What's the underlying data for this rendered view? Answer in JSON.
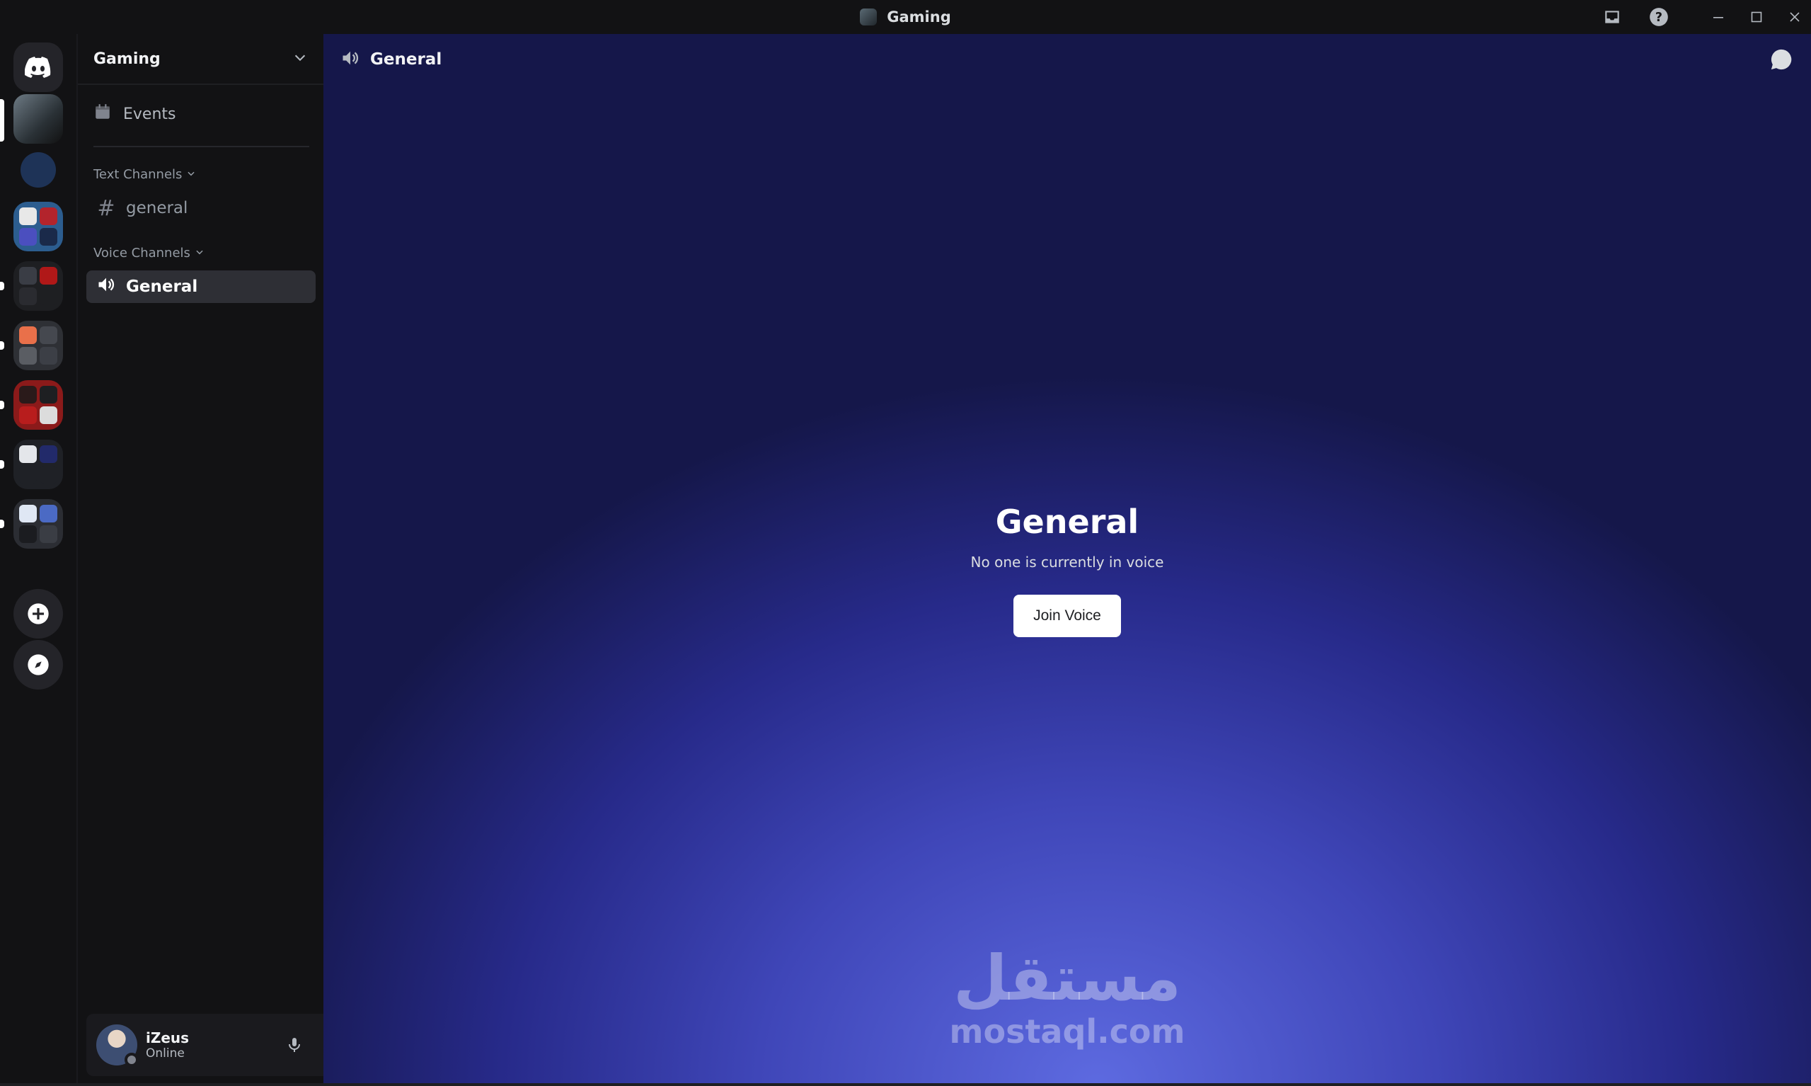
{
  "window": {
    "title": "Gaming",
    "icons": {
      "inbox": "inbox-icon",
      "help": "help-icon",
      "minimize": "minimize-icon",
      "maximize": "maximize-icon",
      "close": "close-icon"
    }
  },
  "server": {
    "name": "Gaming",
    "events_label": "Events",
    "text_category": "Text Channels",
    "voice_category": "Voice Channels",
    "text_channels": [
      {
        "name": "general"
      }
    ],
    "voice_channels": [
      {
        "name": "General",
        "active": true
      }
    ]
  },
  "main": {
    "header_title": "General",
    "voice_title": "General",
    "voice_subtitle": "No one is currently in voice",
    "join_label": "Join Voice"
  },
  "user": {
    "name": "iZeus",
    "status": "Online"
  },
  "watermark": {
    "arabic": "مستقل",
    "latin": "mostaql.com"
  },
  "colors": {
    "accent_blurple": "#5865f2",
    "background": "#121214",
    "active_channel": "#2e2f35"
  }
}
